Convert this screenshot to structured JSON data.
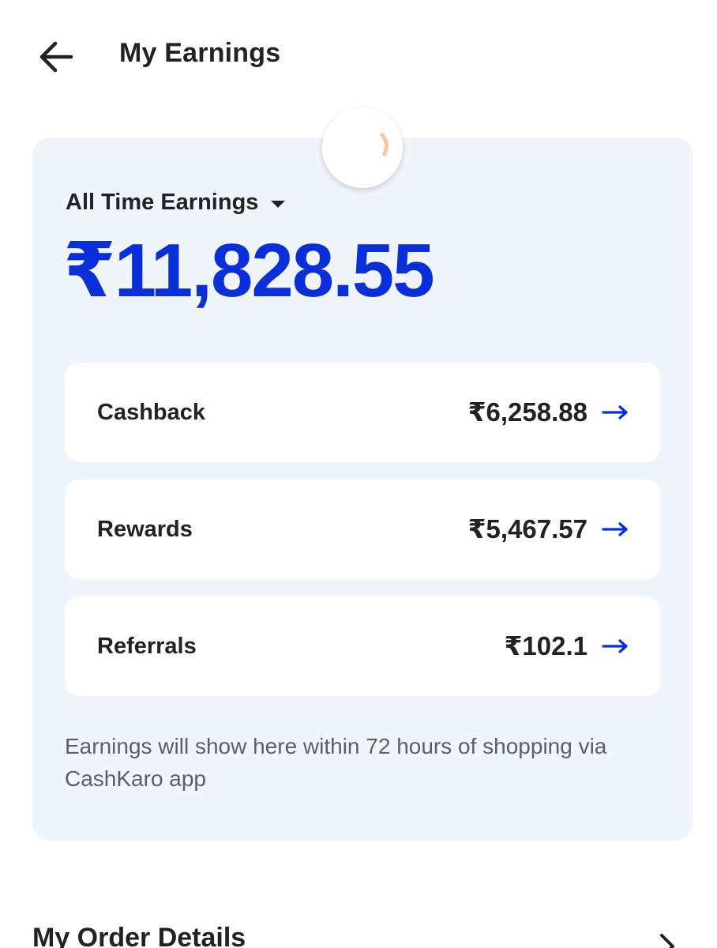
{
  "header": {
    "title": "My Earnings",
    "back_icon": "arrow-left-icon"
  },
  "earnings": {
    "period_label": "All Time Earnings",
    "total": "₹11,828.55",
    "accent_color": "#0a2fd8",
    "rows": [
      {
        "label": "Cashback",
        "amount": "₹6,258.88",
        "icon": "arrow-right-icon"
      },
      {
        "label": "Rewards",
        "amount": "₹5,467.57",
        "icon": "arrow-right-icon"
      },
      {
        "label": "Referrals",
        "amount": "₹102.1",
        "icon": "arrow-right-icon"
      }
    ],
    "info": "Earnings will show here within 72 hours of shopping via CashKaro app"
  },
  "orders": {
    "title": "My Order Details",
    "icon": "chevron-right-icon"
  }
}
